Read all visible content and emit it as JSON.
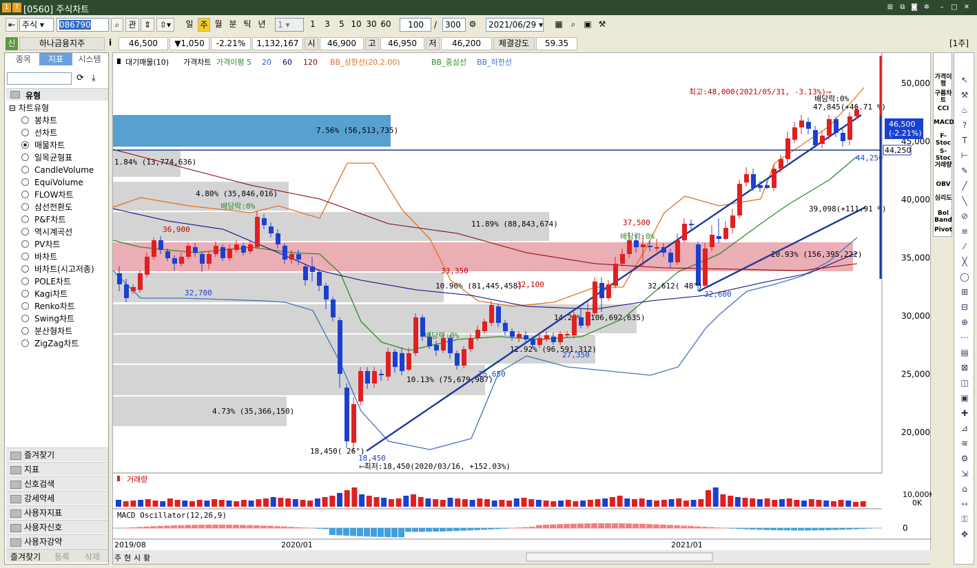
{
  "window": {
    "title": "[0560] 주식차트",
    "badges": [
      "1",
      "?"
    ]
  },
  "toolbar": {
    "market": "주식",
    "code": "086790",
    "btn_gwan": "관",
    "periods": [
      "일",
      "주",
      "월",
      "분",
      "틱",
      "년"
    ],
    "active_period": "주",
    "interval": "1",
    "quick": [
      "1",
      "3",
      "5",
      "10",
      "30",
      "60"
    ],
    "count": "100",
    "total": "300",
    "date": "2021/06/29"
  },
  "info": {
    "sin": "신",
    "name": "하나금융지주",
    "i": "i",
    "price": "46,500",
    "change": "▼1,050",
    "rate": "-2.21%",
    "volume": "1,132,167",
    "open_label": "시",
    "open": "46,900",
    "high_label": "고",
    "high": "46,950",
    "low_label": "저",
    "low": "46,200",
    "strength_label": "체결강도",
    "strength": "59.35",
    "unit": "[1주]"
  },
  "sidebar": {
    "tabs": [
      "종목",
      "지표",
      "시스템"
    ],
    "active_tab": "지표",
    "group": "유형",
    "tree_root": "차트유형",
    "types": [
      "봉차트",
      "선차트",
      "매물차트",
      "일목균형표",
      "CandleVolume",
      "EquiVolume",
      "FLOW차트",
      "삼선전환도",
      "P&F차트",
      "역시계곡선",
      "PV차트",
      "바차트",
      "바차트(시고저종)",
      "POLE차트",
      "Kagi차트",
      "Renko차트",
      "Swing차트",
      "분산형차트",
      "ZigZag차트"
    ],
    "selected": "매물차트",
    "folders": [
      "즐겨찾기",
      "지표",
      "신호검색",
      "강세약세",
      "사용자지표",
      "사용자신호",
      "사용자강약"
    ],
    "bottom": [
      "즐겨찾기",
      "등록",
      "삭제"
    ]
  },
  "chart": {
    "legend": [
      {
        "t": "대기매물(10)",
        "c": "#000000"
      },
      {
        "t": "가격차트",
        "c": "#000000"
      },
      {
        "t": "가격이평 5",
        "c": "#2a8a2a"
      },
      {
        "t": "20",
        "c": "#2060d0"
      },
      {
        "t": "60",
        "c": "#000080"
      },
      {
        "t": "120",
        "c": "#800000"
      },
      {
        "t": "BB_상한선(20,2.00)",
        "c": "#e07020"
      },
      {
        "t": "BB_중심선",
        "c": "#2a8a2a"
      },
      {
        "t": "BB_하한선",
        "c": "#4070c0"
      }
    ],
    "y_ticks": [
      "50,000",
      "45,000",
      "40,000",
      "35,000",
      "30,000",
      "25,000",
      "20,000"
    ],
    "x_ticks": [
      "2019/08",
      "2020/01",
      "2021/01"
    ],
    "price_tag": "46,500",
    "rate_tag": "(-2.21%)",
    "line_tag": "44,250",
    "vp_labels": [
      "7.56% (56,513,735)",
      "1.84% (13,774,636)",
      "4.80% (35,846,016)",
      "11.89% (88,843,674)",
      "20.93% (156,395,222)",
      "10.90% (81,445,458)",
      "14.28% (106,692,635)",
      "12.92% (96,591,312)",
      "10.13% (75,679,987)",
      "4.73% (35,366,150)"
    ],
    "annotations": {
      "max": "최고:48,000(2021/05/31, -3.13%)⟶",
      "min": "⟵최저:18,450(2020/03/16, +152.03%)",
      "div1": "배당락:0%",
      "div2": "배당락:0%",
      "div3": "배당락:0%",
      "div4": "배당락:0%",
      "p36900": "36,900",
      "p32700": "32,700",
      "p33350": "33,350",
      "p32100": "32,100",
      "p25650": "25,650",
      "p27350": "27,350",
      "p18450a": "18,450( 26°)",
      "p18450b": "18,450",
      "p37500": "37,500",
      "p32612": "32,612( 48°)",
      "p32600": "32,600",
      "p47845": "47,845(+46.71 %)",
      "p39098": "39,098(+111.91 %)",
      "p44250": "44,250"
    },
    "volume": {
      "label": "거래량",
      "tick": "10,000K",
      "zero": "0K"
    },
    "macd": {
      "label": "MACD Oscillator(12,26,9)",
      "zero": "0"
    },
    "bottom_tabs": [
      "주",
      "현",
      "시",
      "황"
    ]
  },
  "right_tools": [
    "가격이평",
    "구름차트",
    "CCI",
    "MACD",
    "F-Stoc",
    "S-Stoc",
    "거래량",
    "OBV",
    "심리도",
    "Bol Band",
    "Pivot"
  ]
}
